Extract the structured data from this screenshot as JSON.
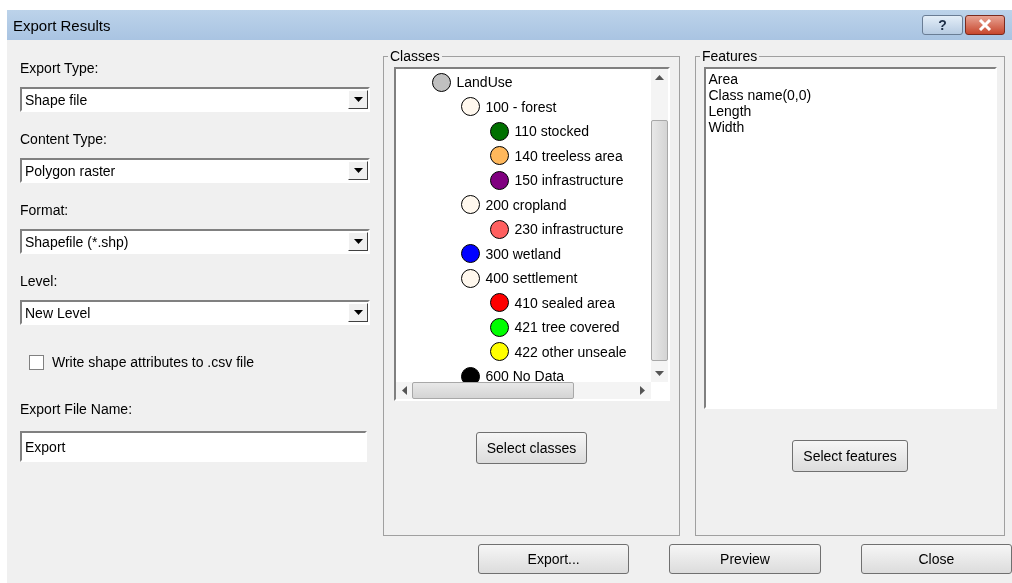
{
  "window": {
    "title": "Export Results",
    "help": "?"
  },
  "left": {
    "fields": [
      {
        "label": "Export Type:",
        "value": "Shape file"
      },
      {
        "label": "Content Type:",
        "value": "Polygon raster"
      },
      {
        "label": "Format:",
        "value": "Shapefile (*.shp)"
      },
      {
        "label": "Level:",
        "value": "New Level"
      }
    ],
    "checkbox": {
      "label": "Write shape attributes to .csv file",
      "checked": false
    },
    "file_name": {
      "label": "Export File Name:",
      "value": "Export"
    }
  },
  "classes": {
    "title": "Classes",
    "tree": [
      {
        "label": "LandUse",
        "color": "#c0c0c0",
        "children": [
          {
            "label": "100 - forest",
            "color": "#fff8ee",
            "children": [
              {
                "label": "110 stocked",
                "color": "#007000"
              },
              {
                "label": "140 treeless area",
                "color": "#ffb85c"
              },
              {
                "label": "150 infrastructure",
                "color": "#800080"
              }
            ]
          },
          {
            "label": "200 cropland",
            "color": "#fff8ee",
            "children": [
              {
                "label": "230 infrastructure",
                "color": "#ff6060"
              }
            ]
          },
          {
            "label": "300 wetland",
            "color": "#0000ff"
          },
          {
            "label": "400 settlement",
            "color": "#fff8ee",
            "children": [
              {
                "label": "410 sealed area",
                "color": "#ff0000"
              },
              {
                "label": "421 tree covered",
                "color": "#00ff00"
              },
              {
                "label": "422 other unseale",
                "color": "#ffff00"
              }
            ]
          },
          {
            "label": "600 No Data",
            "color": "#000000"
          }
        ]
      }
    ],
    "button": "Select classes"
  },
  "features": {
    "title": "Features",
    "items": [
      "Area",
      "Class name(0,0)",
      "Length",
      "Width"
    ],
    "button": "Select features"
  },
  "buttons": [
    "Export...",
    "Preview",
    "Close"
  ]
}
